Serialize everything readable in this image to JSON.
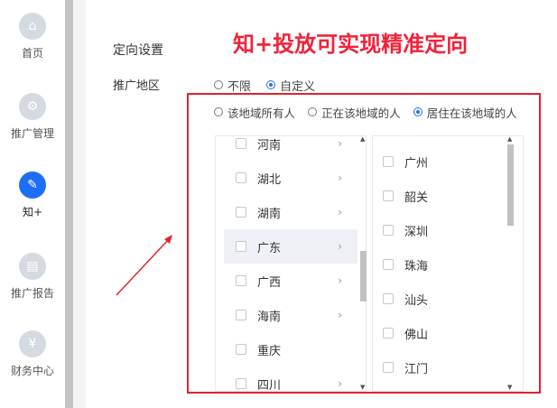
{
  "sidebar": {
    "items": [
      {
        "label": "首页",
        "icon": "home-icon",
        "glyph": "⌂",
        "active": false
      },
      {
        "label": "推广管理",
        "icon": "gear-icon",
        "glyph": "⚙",
        "active": false
      },
      {
        "label": "知+",
        "icon": "edit-icon",
        "glyph": "✎",
        "active": true
      },
      {
        "label": "推广报告",
        "icon": "report-icon",
        "glyph": "▤",
        "active": false
      },
      {
        "label": "财务中心",
        "icon": "yen-icon",
        "glyph": "¥",
        "active": false
      }
    ]
  },
  "main": {
    "section_title": "定向设置",
    "headline": "知+投放可实现精准定向",
    "region_label": "推广地区",
    "scope_options": [
      {
        "label": "不限",
        "checked": false
      },
      {
        "label": "自定义",
        "checked": true
      }
    ],
    "resident_options": [
      {
        "label": "该地域所有人",
        "checked": false
      },
      {
        "label": "正在该地域的人",
        "checked": false
      },
      {
        "label": "居住在该地域的人",
        "checked": true
      }
    ],
    "provinces": [
      {
        "name": "河南",
        "has_children": true,
        "selected": false
      },
      {
        "name": "湖北",
        "has_children": true,
        "selected": false
      },
      {
        "name": "湖南",
        "has_children": true,
        "selected": false
      },
      {
        "name": "广东",
        "has_children": true,
        "selected": true
      },
      {
        "name": "广西",
        "has_children": true,
        "selected": false
      },
      {
        "name": "海南",
        "has_children": true,
        "selected": false
      },
      {
        "name": "重庆",
        "has_children": false,
        "selected": false
      },
      {
        "name": "四川",
        "has_children": true,
        "selected": false
      }
    ],
    "cities": [
      "广州",
      "韶关",
      "深圳",
      "珠海",
      "汕头",
      "佛山",
      "江门"
    ]
  },
  "colors": {
    "accent": "#1e6ef5",
    "highlight_box": "#e0242f",
    "headline": "#f0233a"
  }
}
